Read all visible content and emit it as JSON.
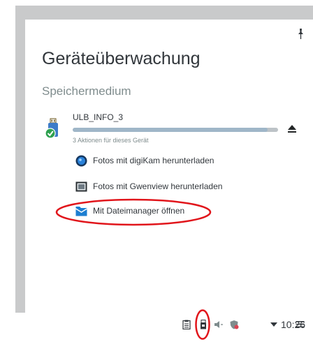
{
  "popup": {
    "title": "Geräteüberwachung",
    "section": "Speichermedium",
    "pin_icon": "pin-icon"
  },
  "device": {
    "name": "ULB_INFO_3",
    "actions_count": "3 Aktionen für dieses Gerät",
    "usage_fraction": 0.95,
    "icon": "usb-stick-icon",
    "eject_icon": "eject-icon"
  },
  "actions": [
    {
      "label": "Fotos mit digiKam herunterladen",
      "icon": "digikam-icon"
    },
    {
      "label": "Fotos mit Gwenview herunterladen",
      "icon": "gwenview-icon"
    },
    {
      "label": "Mit Dateimanager öffnen",
      "icon": "folder-icon"
    }
  ],
  "taskbar": {
    "clock": "10:26",
    "tray_icons": [
      "clipboard-icon",
      "device-notifier-icon",
      "volume-icon",
      "network-shield-icon",
      "expand-arrow-icon"
    ],
    "menu_icon": "hamburger-menu-icon"
  },
  "colors": {
    "text": "#31363b",
    "muted": "#7f8c8d",
    "annotation": "#e1151b",
    "popup_shadow": "#c9cacb",
    "bar_fill": "#9fb6c8"
  }
}
